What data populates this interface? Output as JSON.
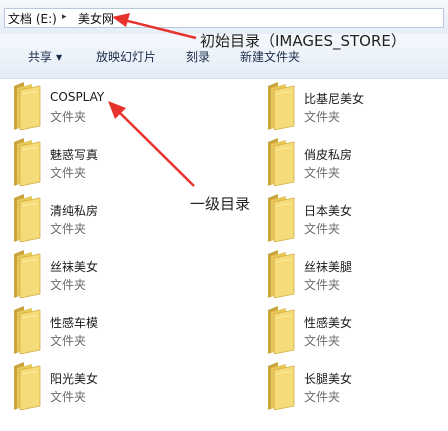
{
  "breadcrumb": {
    "drive": "文档 (E:)",
    "separator": "▸",
    "folder": "美女网"
  },
  "toolbar": {
    "share": "共享",
    "slideshow": "放映幻灯片",
    "burn": "刻录",
    "new_folder": "新建文件夹"
  },
  "folder_type": "文件夹",
  "folders_left": [
    "COSPLAY",
    "魅惑写真",
    "清纯私房",
    "丝袜美女",
    "性感车模",
    "阳光美女"
  ],
  "folders_right": [
    "比基尼美女",
    "俏皮私房",
    "日本美女",
    "丝袜美腿",
    "性感美女",
    "长腿美女"
  ],
  "annotations": {
    "initial_dir": "初始目录（IMAGES_STORE）",
    "level1_dir": "一级目录"
  },
  "colors": {
    "arrow": "#e8322e",
    "folder_front": "#f3d56c",
    "folder_back": "#d9b243"
  },
  "icons": {
    "folder": "folder-icon",
    "dropdown": "caret-down-icon"
  }
}
